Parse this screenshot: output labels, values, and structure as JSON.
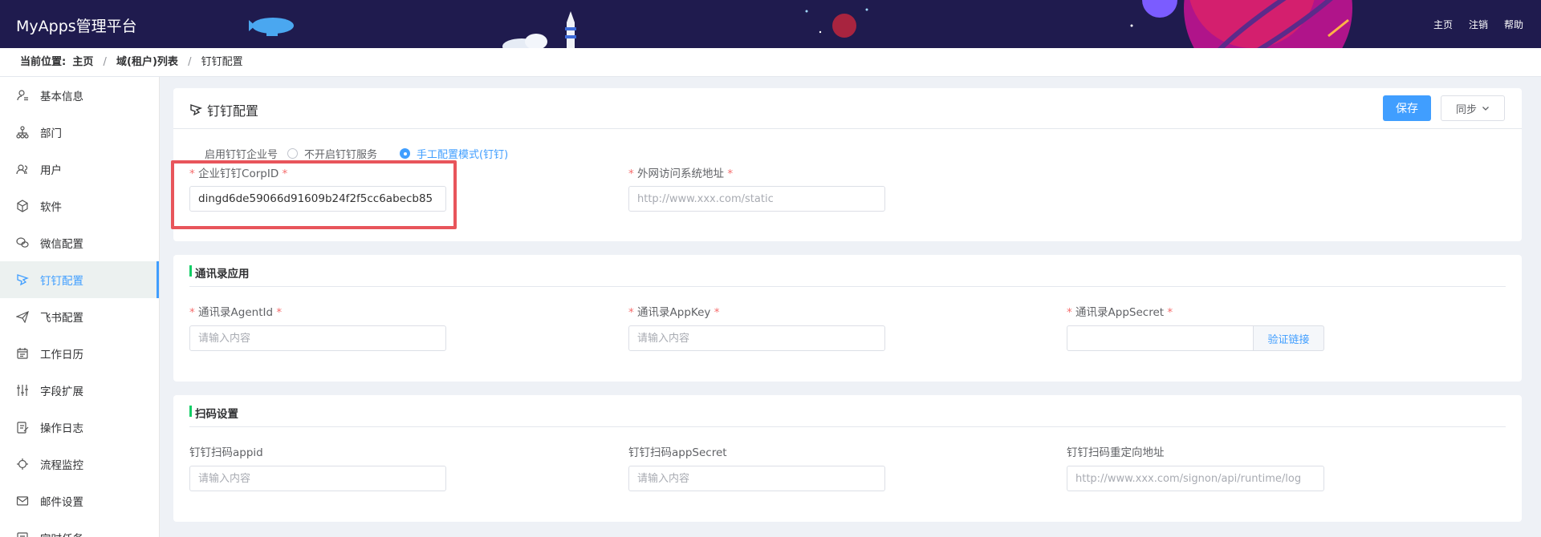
{
  "header": {
    "app_title": "MyApps管理平台",
    "nav": [
      "主页",
      "注销",
      "帮助"
    ]
  },
  "breadcrumb": {
    "prefix": "当前位置:",
    "items": [
      "主页",
      "域(租户)列表",
      "钉钉配置"
    ],
    "separator": "/"
  },
  "sidebar": {
    "items": [
      {
        "label": "基本信息",
        "icon": "user-info-icon"
      },
      {
        "label": "部门",
        "icon": "org-tree-icon"
      },
      {
        "label": "用户",
        "icon": "users-icon"
      },
      {
        "label": "软件",
        "icon": "cube-icon"
      },
      {
        "label": "微信配置",
        "icon": "wechat-icon"
      },
      {
        "label": "钉钉配置",
        "icon": "dingtalk-icon",
        "active": true
      },
      {
        "label": "飞书配置",
        "icon": "feishu-icon"
      },
      {
        "label": "工作日历",
        "icon": "calendar-icon"
      },
      {
        "label": "字段扩展",
        "icon": "sliders-icon"
      },
      {
        "label": "操作日志",
        "icon": "log-icon"
      },
      {
        "label": "流程监控",
        "icon": "monitor-icon"
      },
      {
        "label": "邮件设置",
        "icon": "mail-icon"
      },
      {
        "label": "定时任务",
        "icon": "timer-icon"
      }
    ]
  },
  "card1": {
    "title": "钉钉配置",
    "save_label": "保存",
    "sync_label": "同步",
    "radio_label": "启用钉钉企业号",
    "radio_options": [
      "不开启钉钉服务",
      "手工配置模式(钉钉)"
    ],
    "radio_selected_index": 1,
    "corpid_label": "企业钉钉CorpID",
    "corpid_value": "dingd6de59066d91609b24f2f5cc6abecb85",
    "external_url_label": "外网访问系统地址",
    "external_url_placeholder": "http://www.xxx.com/static"
  },
  "card2": {
    "section_title": "通讯录应用",
    "agentid_label": "通讯录AgentId",
    "agentid_placeholder": "请输入内容",
    "appkey_label": "通讯录AppKey",
    "appkey_placeholder": "请输入内容",
    "appsecret_label": "通讯录AppSecret",
    "appsecret_placeholder": "",
    "verify_label": "验证链接"
  },
  "card3": {
    "section_title": "扫码设置",
    "appid_label": "钉钉扫码appid",
    "appid_placeholder": "请输入内容",
    "appsecret_label": "钉钉扫码appSecret",
    "appsecret_placeholder": "请输入内容",
    "redirect_label": "钉钉扫码重定向地址",
    "redirect_placeholder": "http://www.xxx.com/signon/api/runtime/log"
  },
  "required_mark": "*",
  "colors": {
    "header_bg": "#1f1b4e",
    "primary": "#409eff",
    "highlight": "#e8555b",
    "section_accent": "#13ce66"
  }
}
